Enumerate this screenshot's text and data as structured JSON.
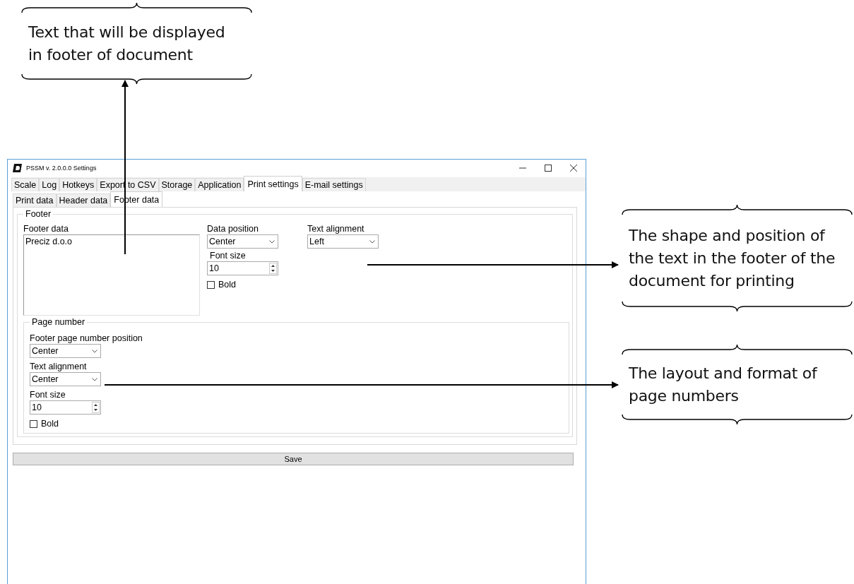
{
  "annotations": [
    {
      "lines": [
        "Text that will be displayed",
        "in footer of document"
      ]
    },
    {
      "lines": [
        "The shape and position of",
        "the text in the footer of the",
        "document for printing"
      ]
    },
    {
      "lines": [
        "The layout and format of",
        "page numbers"
      ]
    }
  ],
  "window": {
    "title": "PSSM v. 2.0.0.0 Settings"
  },
  "tabs": [
    {
      "label": "Scale",
      "selected": false
    },
    {
      "label": "Log",
      "selected": false
    },
    {
      "label": "Hotkeys",
      "selected": false
    },
    {
      "label": "Export to CSV",
      "selected": false
    },
    {
      "label": "Storage",
      "selected": false
    },
    {
      "label": "Application",
      "selected": false
    },
    {
      "label": "Print settings",
      "selected": true
    },
    {
      "label": "E-mail settings",
      "selected": false
    }
  ],
  "subtabs": [
    {
      "label": "Print data",
      "selected": false
    },
    {
      "label": "Header data",
      "selected": false
    },
    {
      "label": "Footer data",
      "selected": true
    }
  ],
  "footer_group": {
    "title": "Footer",
    "footer_data": {
      "label": "Footer data",
      "value": "Preciz d.o.o"
    },
    "data_position": {
      "label": "Data position",
      "value": "Center"
    },
    "text_alignment": {
      "label": "Text alignment",
      "value": "Left"
    },
    "font_size": {
      "label": "Font size",
      "value": "10"
    },
    "bold": {
      "label": "Bold",
      "checked": false
    }
  },
  "page_number_group": {
    "title": "Page number",
    "position": {
      "label": "Footer page number position",
      "value": "Center"
    },
    "text_alignment": {
      "label": "Text alignment",
      "value": "Center"
    },
    "font_size": {
      "label": "Font size",
      "value": "10"
    },
    "bold": {
      "label": "Bold",
      "checked": false
    }
  },
  "save_button": "Save"
}
